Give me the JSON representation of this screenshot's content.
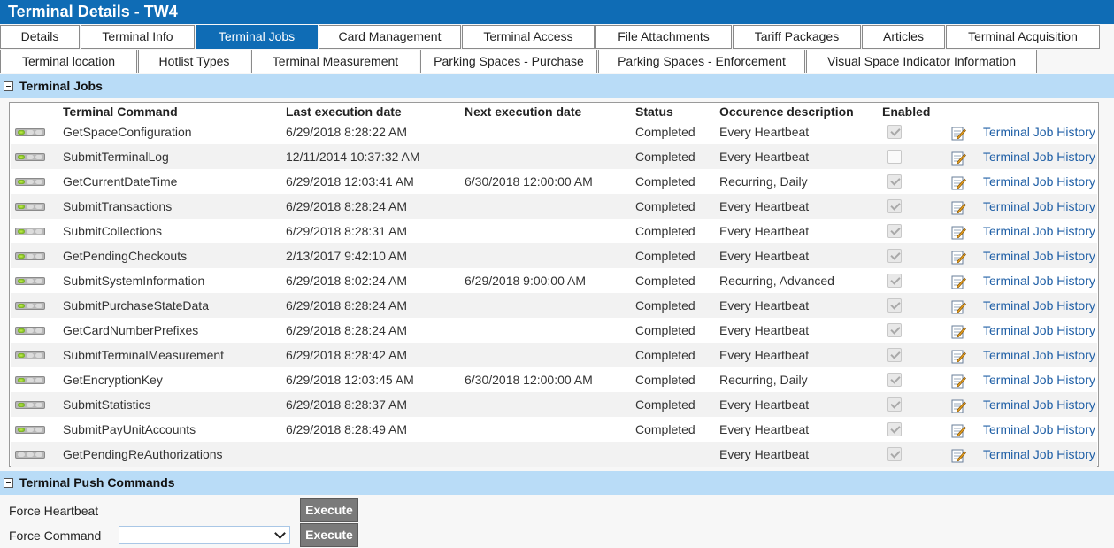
{
  "title": "Terminal Details - TW4",
  "tabs_row1": [
    {
      "label": "Details",
      "w": 90,
      "active": false
    },
    {
      "label": "Terminal Info",
      "w": 129,
      "active": false
    },
    {
      "label": "Terminal Jobs",
      "w": 138,
      "active": true
    },
    {
      "label": "Card Management",
      "w": 161,
      "active": false
    },
    {
      "label": "Terminal Access",
      "w": 150,
      "active": false
    },
    {
      "label": "File Attachments",
      "w": 154,
      "active": false
    },
    {
      "label": "Tariff Packages",
      "w": 145,
      "active": false
    },
    {
      "label": "Articles",
      "w": 94,
      "active": false
    },
    {
      "label": "Terminal Acquisition",
      "w": 174,
      "active": false
    }
  ],
  "tabs_row2": [
    {
      "label": "Terminal location",
      "w": 155,
      "active": false
    },
    {
      "label": "Hotlist Types",
      "w": 127,
      "active": false
    },
    {
      "label": "Terminal Measurement",
      "w": 190,
      "active": false
    },
    {
      "label": "Parking Spaces - Purchase",
      "w": 200,
      "active": false
    },
    {
      "label": "Parking Spaces - Enforcement",
      "w": 234,
      "active": false
    },
    {
      "label": "Visual Space Indicator Information",
      "w": 261,
      "active": false
    }
  ],
  "jobs_section": {
    "title": "Terminal Jobs"
  },
  "columns": {
    "command": "Terminal Command",
    "last": "Last execution date",
    "next": "Next execution date",
    "status": "Status",
    "occurrence": "Occurence description",
    "enabled": "Enabled"
  },
  "history_label": "Terminal Job History",
  "rows": [
    {
      "command": "GetSpaceConfiguration",
      "last": "6/29/2018 8:28:22 AM",
      "next": "",
      "status": "Completed",
      "occurrence": "Every Heartbeat",
      "enabled": true,
      "active": true
    },
    {
      "command": "SubmitTerminalLog",
      "last": "12/11/2014 10:37:32 AM",
      "next": "",
      "status": "Completed",
      "occurrence": "Every Heartbeat",
      "enabled": false,
      "active": true
    },
    {
      "command": "GetCurrentDateTime",
      "last": "6/29/2018 12:03:41 AM",
      "next": "6/30/2018 12:00:00 AM",
      "status": "Completed",
      "occurrence": "Recurring, Daily",
      "enabled": true,
      "active": true
    },
    {
      "command": "SubmitTransactions",
      "last": "6/29/2018 8:28:24 AM",
      "next": "",
      "status": "Completed",
      "occurrence": "Every Heartbeat",
      "enabled": true,
      "active": true
    },
    {
      "command": "SubmitCollections",
      "last": "6/29/2018 8:28:31 AM",
      "next": "",
      "status": "Completed",
      "occurrence": "Every Heartbeat",
      "enabled": true,
      "active": true
    },
    {
      "command": "GetPendingCheckouts",
      "last": "2/13/2017 9:42:10 AM",
      "next": "",
      "status": "Completed",
      "occurrence": "Every Heartbeat",
      "enabled": true,
      "active": true
    },
    {
      "command": "SubmitSystemInformation",
      "last": "6/29/2018 8:02:24 AM",
      "next": "6/29/2018 9:00:00 AM",
      "status": "Completed",
      "occurrence": "Recurring, Advanced",
      "enabled": true,
      "active": true
    },
    {
      "command": "SubmitPurchaseStateData",
      "last": "6/29/2018 8:28:24 AM",
      "next": "",
      "status": "Completed",
      "occurrence": "Every Heartbeat",
      "enabled": true,
      "active": true
    },
    {
      "command": "GetCardNumberPrefixes",
      "last": "6/29/2018 8:28:24 AM",
      "next": "",
      "status": "Completed",
      "occurrence": "Every Heartbeat",
      "enabled": true,
      "active": true
    },
    {
      "command": "SubmitTerminalMeasurement",
      "last": "6/29/2018 8:28:42 AM",
      "next": "",
      "status": "Completed",
      "occurrence": "Every Heartbeat",
      "enabled": true,
      "active": true
    },
    {
      "command": "GetEncryptionKey",
      "last": "6/29/2018 12:03:45 AM",
      "next": "6/30/2018 12:00:00 AM",
      "status": "Completed",
      "occurrence": "Recurring, Daily",
      "enabled": true,
      "active": true
    },
    {
      "command": "SubmitStatistics",
      "last": "6/29/2018 8:28:37 AM",
      "next": "",
      "status": "Completed",
      "occurrence": "Every Heartbeat",
      "enabled": true,
      "active": true
    },
    {
      "command": "SubmitPayUnitAccounts",
      "last": "6/29/2018 8:28:49 AM",
      "next": "",
      "status": "Completed",
      "occurrence": "Every Heartbeat",
      "enabled": true,
      "active": true
    },
    {
      "command": "GetPendingReAuthorizations",
      "last": "",
      "next": "",
      "status": "",
      "occurrence": "Every Heartbeat",
      "enabled": true,
      "active": false
    }
  ],
  "push_section": {
    "title": "Terminal Push Commands"
  },
  "push": {
    "heartbeat_label": "Force Heartbeat",
    "command_label": "Force Command",
    "execute_label": "Execute",
    "command_value": ""
  },
  "icons": {
    "collapse": "collapse-minus-icon",
    "status": "status-led-icon",
    "edit": "edit-note-icon",
    "chevron": "chevron-down-icon"
  },
  "colors": {
    "header": "#0f6cb5",
    "section": "#b9dcf7",
    "link": "#1f5fa6",
    "button": "#7a7a7a"
  }
}
